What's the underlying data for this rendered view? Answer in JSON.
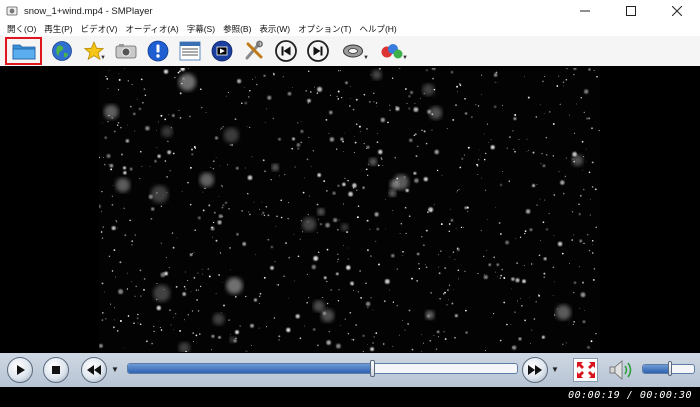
{
  "window": {
    "title": "snow_1+wind.mp4 - SMPlayer",
    "app_icon": "smplayer-app-icon",
    "controls": [
      "minimize",
      "maximize",
      "close"
    ]
  },
  "menu": {
    "items": [
      {
        "label": "開く(O)"
      },
      {
        "label": "再生(P)"
      },
      {
        "label": "ビデオ(V)"
      },
      {
        "label": "オーディオ(A)"
      },
      {
        "label": "字幕(S)"
      },
      {
        "label": "参照(B)"
      },
      {
        "label": "表示(W)"
      },
      {
        "label": "オプション(T)"
      },
      {
        "label": "ヘルプ(H)"
      }
    ]
  },
  "toolbar": {
    "buttons": [
      {
        "icon": "open-folder-icon",
        "selected": true
      },
      {
        "icon": "globe-icon"
      },
      {
        "icon": "favorites-star-icon",
        "dropdown": true
      },
      {
        "icon": "screenshot-camera-icon"
      },
      {
        "icon": "info-icon"
      },
      {
        "icon": "playlist-icon"
      },
      {
        "icon": "video-equalizer-icon"
      },
      {
        "icon": "preferences-tools-icon"
      },
      {
        "icon": "previous-icon"
      },
      {
        "icon": "next-icon"
      },
      {
        "icon": "audio-disc-icon",
        "dropdown": true
      },
      {
        "icon": "subtitles-abc-icon",
        "dropdown": true
      }
    ]
  },
  "video": {
    "content": "snowfall"
  },
  "controls": {
    "seek_progress": 0.63,
    "volume_level": 0.52,
    "accent_color": "#2e62b1"
  },
  "status": {
    "time_text": "00:00:19 / 00:00:30"
  }
}
